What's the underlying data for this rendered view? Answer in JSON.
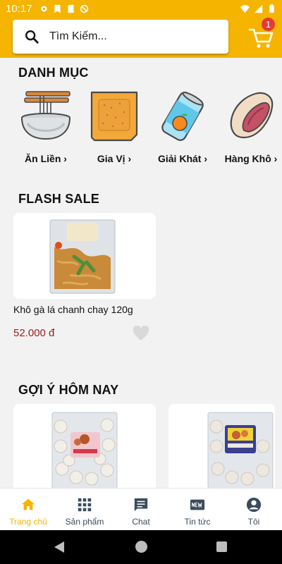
{
  "status_bar": {
    "time": "10:17"
  },
  "search": {
    "placeholder": "Tìm Kiếm..."
  },
  "cart": {
    "badge_count": "1"
  },
  "categories_section": {
    "title": "DANH MỤC",
    "items": [
      {
        "label": "Ăn Liền ›",
        "icon": "noodle-bowl-icon"
      },
      {
        "label": "Gia Vị ›",
        "icon": "seasoning-packet-icon"
      },
      {
        "label": "Giải Khát ›",
        "icon": "drink-can-icon"
      },
      {
        "label": "Hàng Khô ›",
        "icon": "pistachio-icon"
      }
    ]
  },
  "flash_sale": {
    "title": "FLASH SALE",
    "products": [
      {
        "name": "Khô gà lá chanh chay 120g",
        "price": "52.000 đ"
      }
    ]
  },
  "suggestions": {
    "title": "GỢI Ý HÔM NAY"
  },
  "bottom_nav": {
    "items": [
      {
        "label": "Trang chủ",
        "icon": "home-icon",
        "active": true
      },
      {
        "label": "Sản phẩm",
        "icon": "grid-icon",
        "active": false
      },
      {
        "label": "Chat",
        "icon": "chat-icon",
        "active": false
      },
      {
        "label": "Tin tức",
        "icon": "news-icon",
        "active": false
      },
      {
        "label": "Tôi",
        "icon": "account-icon",
        "active": false
      }
    ]
  },
  "colors": {
    "accent": "#f5b400",
    "price": "#9b1c1c",
    "badge": "#e53935",
    "nav_text": "#3b4b5c"
  }
}
